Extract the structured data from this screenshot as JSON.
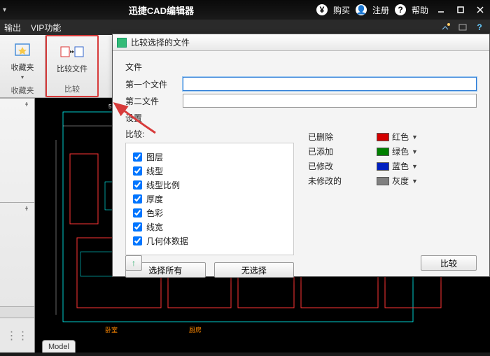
{
  "titlebar": {
    "app_title": "迅捷CAD编辑器",
    "buy": "购买",
    "register": "注册",
    "help": "帮助"
  },
  "menubar": {
    "output": "输出",
    "vip": "VIP功能"
  },
  "ribbon": {
    "favorites_btn": "收藏夹",
    "favorites_group": "收藏夹",
    "compare_btn": "比较文件",
    "compare_group": "比较"
  },
  "dialog": {
    "title": "比较选择的文件",
    "file_section": "文件",
    "first_file_label": "第一个文件",
    "second_file_label": "第二文件",
    "first_file_value": "",
    "second_file_value": "",
    "settings_section": "设置",
    "compare_label": "比较:",
    "checks": {
      "layer": "图层",
      "linetype": "线型",
      "ltscale": "线型比例",
      "thickness": "厚度",
      "color": "色彩",
      "lineweight": "线宽",
      "geometry": "几何体数据"
    },
    "select_all": "选择所有",
    "select_none": "无选择",
    "status": {
      "deleted": "已删除",
      "added": "已添加",
      "modified": "已修改",
      "unchanged": "未修改的"
    },
    "colors": {
      "red": "红色",
      "green": "绿色",
      "blue": "蓝色",
      "gray": "灰度"
    },
    "color_values": {
      "red": "#d40000",
      "green": "#008000",
      "blue": "#0020c0",
      "gray": "#808080"
    },
    "compare_button": "比较"
  },
  "model_tab": "Model"
}
